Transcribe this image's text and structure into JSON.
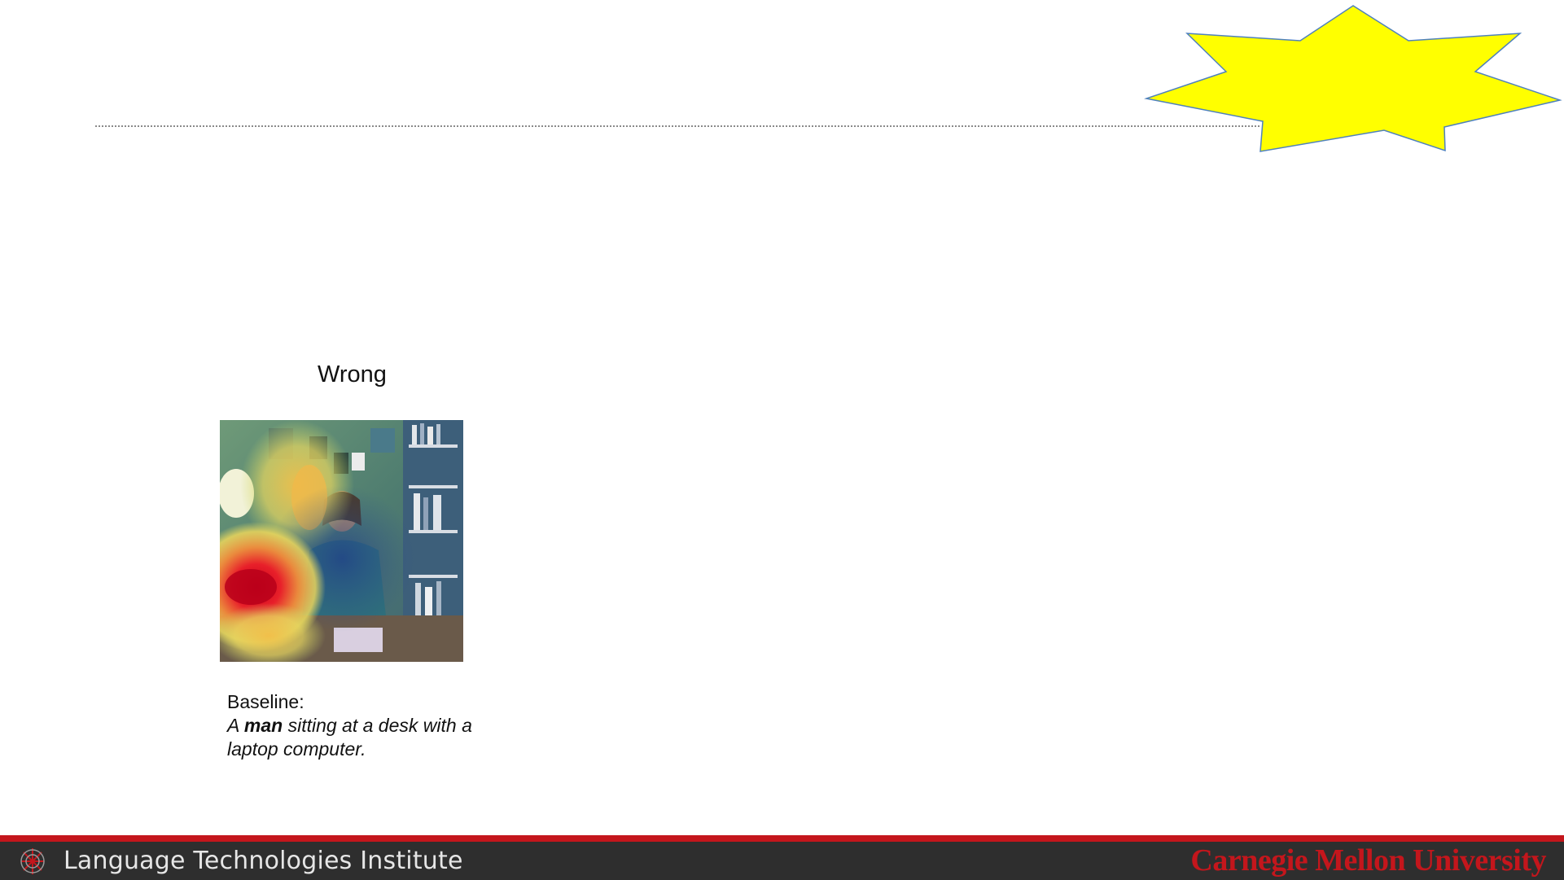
{
  "panel": {
    "heading": "Wrong",
    "caption_label": "Baseline:",
    "caption_prefix": "A ",
    "caption_emphasis": "man",
    "caption_rest": " sitting at a desk with a laptop computer."
  },
  "footer": {
    "institute": "Language Technologies Institute",
    "university": "Carnegie Mellon University"
  },
  "colors": {
    "starburst_fill": "#ffff00",
    "starburst_stroke": "#4f81bd",
    "footer_bar": "#2e2e2e",
    "accent_red": "#c4161c"
  },
  "icons": {
    "decoration": "starburst-shape",
    "logo": "lti-logo-icon"
  }
}
